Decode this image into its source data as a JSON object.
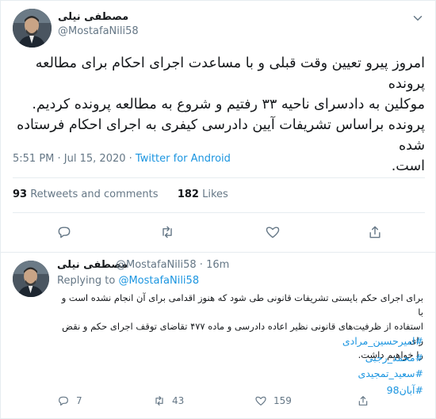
{
  "main_tweet": {
    "author_name": "مصطفی نیلی",
    "author_handle": "@MostafaNili58",
    "text_line1": "امروز پیرو تعیین وقت قبلی و با مساعدت اجرای احکام برای مطالعه پرونده",
    "text_line2": "موکلین به دادسرای ناحیه ۳۳ رفتیم و شروع به مطالعه پرونده کردیم.",
    "text_line3": "پرونده براساس تشریفات آیین دادرسی کیفری به اجرای احکام فرستاده شده",
    "text_line4": "است.",
    "time": "5:51 PM",
    "date": "Jul 15, 2020",
    "source": "Twitter for Android",
    "retweets_count": "93",
    "retweets_label": "Retweets and comments",
    "likes_count": "182",
    "likes_label": "Likes",
    "icons": [
      "reply-icon",
      "retweet-icon",
      "like-icon",
      "share-icon"
    ]
  },
  "reply_tweet": {
    "author_name": "مصطفی نیلی",
    "author_handle": "@MostafaNili58",
    "age": "16m",
    "replying_prefix": "Replying to",
    "replying_to": "@MostafaNili58",
    "text_line1": "برای اجرای حکم بایستی تشریفات قانونی طی شود که هنوز اقدامی برای آن انجام نشده است و با",
    "text_line2": "استفاده از ظرفیت‌های قانونی نظیر اعاده دادرسی و ماده ۴۷۷ تقاضای توقف اجرای حکم و نقض رای",
    "text_line3": "را خواهیم داشت.",
    "hashtags": [
      "#امیرحسین_مرادی",
      "#محمد_رجبی",
      "#سعید_تمجیدی",
      "#آبان98"
    ],
    "reply_count": "7",
    "retweet_count": "43",
    "like_count": "159"
  },
  "colors": {
    "link": "#1b95e0",
    "muted": "#657786",
    "text": "#14171a",
    "border": "#e6ecf0"
  }
}
